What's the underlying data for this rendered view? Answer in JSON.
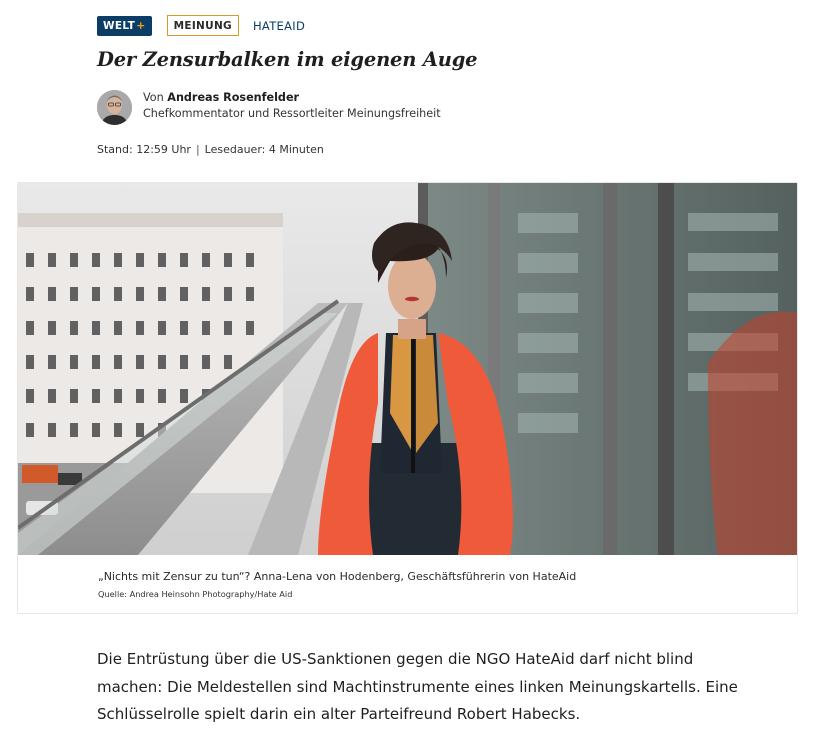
{
  "brand": {
    "badge_text": "WELT",
    "badge_plus": "+",
    "badge_color": "#0b3d66",
    "plus_color": "#f2a20f"
  },
  "kicker": {
    "label": "MEINUNG",
    "border_color": "#d79b2d"
  },
  "topic": {
    "label": "HATEAID",
    "color": "#0b3d66"
  },
  "article": {
    "headline": "Der Zensurbalken im eigenen Auge",
    "author_prefix": "Von",
    "author_name": "Andreas Rosenfelder",
    "author_role": "Chefkommentator und Ressortleiter Meinungsfreiheit",
    "stand": "Stand: 12:59 Uhr",
    "separator": "|",
    "reading_time": "Lesedauer: 4 Minuten",
    "lead": "Die Entrüstung über die US-Sanktionen gegen die NGO HateAid darf nicht blind machen: Die Meldestellen sind Machtinstrumente eines linken Meinungskartells. Eine Schlüsselrolle spielt darin ein alter Parteifreund Robert Habecks."
  },
  "figure": {
    "caption": "„Nichts mit Zensur zu tun“? Anna-Lena von Hodenberg, Geschäftsführerin von HateAid",
    "credit": "Quelle: Andrea Heinsohn Photography/Hate Aid",
    "coat_color": "#f0553a"
  }
}
